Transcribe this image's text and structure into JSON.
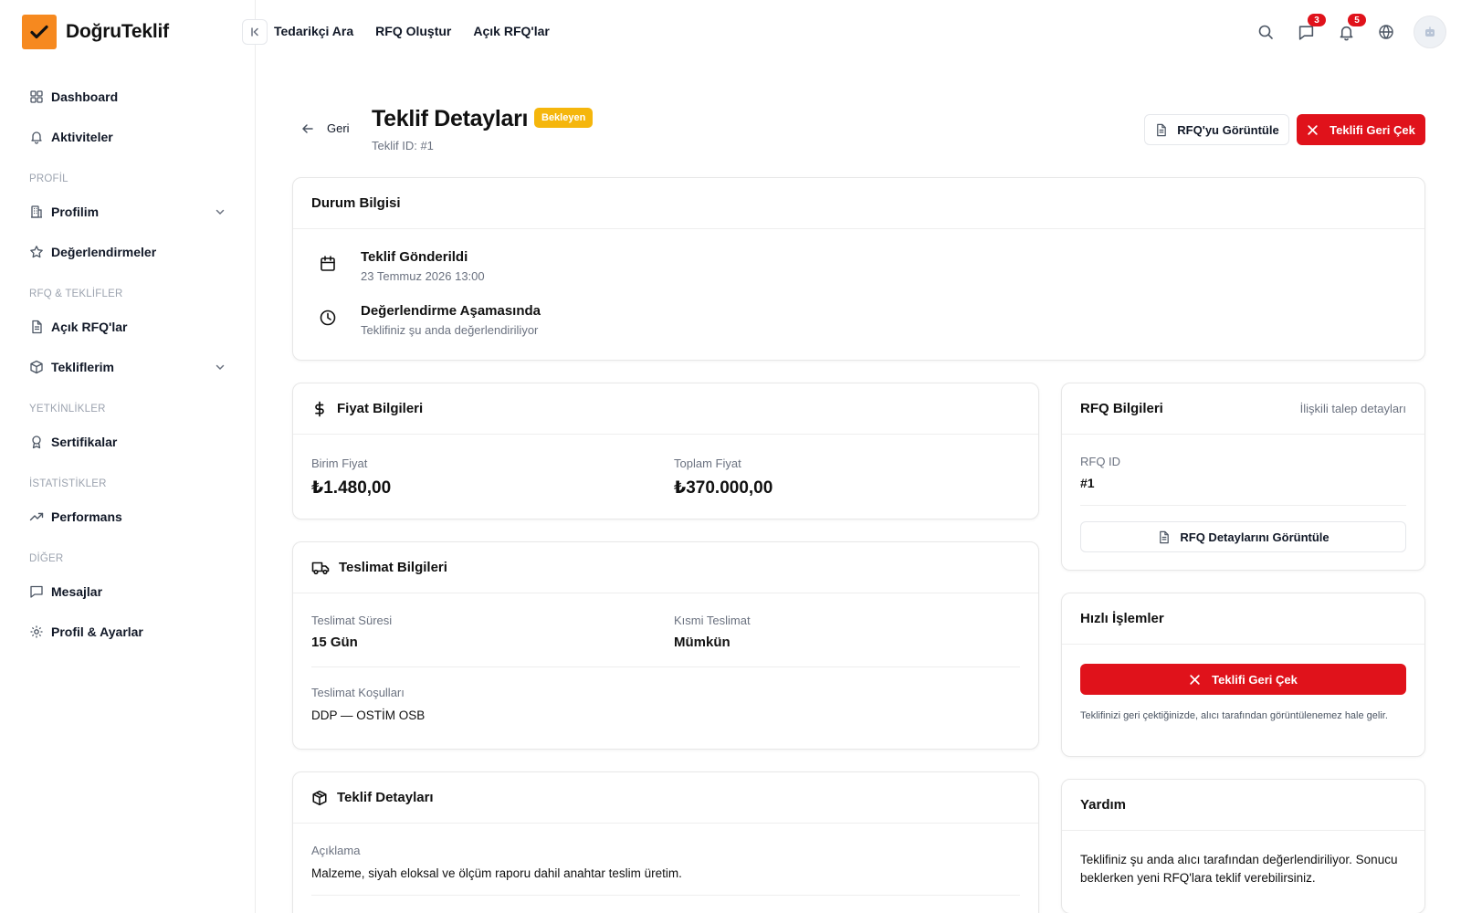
{
  "brand": {
    "name": "DoğruTeklif",
    "accent": "#f6891f"
  },
  "sidebar": {
    "items": [
      {
        "label": "Dashboard"
      },
      {
        "label": "Aktiviteler"
      },
      {
        "section": "PROFİL"
      },
      {
        "label": "Profilim"
      },
      {
        "label": "Değerlendirmeler"
      },
      {
        "section": "RFQ & TEKLİFLER"
      },
      {
        "label": "Açık RFQ'lar"
      },
      {
        "label": "Tekliflerim"
      },
      {
        "section": "YETKİNLİKLER"
      },
      {
        "label": "Sertifikalar"
      },
      {
        "section": "İSTATİSTİKLER"
      },
      {
        "label": "Performans"
      },
      {
        "section": "DİĞER"
      },
      {
        "label": "Mesajlar"
      },
      {
        "label": "Profil & Ayarlar"
      }
    ]
  },
  "topnav": {
    "items": [
      "Tedarikçi Ara",
      "RFQ Oluştur",
      "Açık RFQ'lar"
    ]
  },
  "topbar": {
    "messages_count": "3",
    "notifications_count": "5"
  },
  "header": {
    "back_label": "Geri",
    "title": "Teklif Detayları",
    "status": "Bekleyen",
    "subtitle": "Teklif ID: #1",
    "view_rfq_button": "RFQ'yu Görüntüle",
    "withdraw_button": "Teklifi Geri Çek"
  },
  "status_card": {
    "title": "Durum Bilgisi",
    "events": [
      {
        "title": "Teklif Gönderildi",
        "subtitle": "23 Temmuz 2026 13:00"
      },
      {
        "title": "Değerlendirme Aşamasında",
        "subtitle": "Teklifiniz şu anda değerlendiriliyor"
      }
    ]
  },
  "price_card": {
    "title": "Fiyat Bilgileri",
    "unit_price_label": "Birim Fiyat",
    "unit_price": "₺1.480,00",
    "total_price_label": "Toplam Fiyat",
    "total_price": "₺370.000,00"
  },
  "delivery_card": {
    "title": "Teslimat Bilgileri",
    "duration_label": "Teslimat Süresi",
    "duration": "15 Gün",
    "partial_label": "Kısmi Teslimat",
    "partial": "Mümkün",
    "terms_label": "Teslimat Koşulları",
    "terms": "DDP — OSTİM OSB"
  },
  "offer_card": {
    "title": "Teklif Detayları",
    "description_label": "Açıklama",
    "description": "Malzeme, siyah eloksal ve ölçüm raporu dahil anahtar teslim üretim."
  },
  "rfq_card": {
    "title": "RFQ Bilgileri",
    "aside": "İlişkili talep detayları",
    "id_label": "RFQ ID",
    "id": "#1",
    "details_button": "RFQ Detaylarını Görüntüle"
  },
  "quick_card": {
    "title": "Hızlı İşlemler",
    "button": "Teklifi Geri Çek",
    "note": "Teklifinizi geri çektiğinizde, alıcı tarafından görüntülenemez hale gelir."
  },
  "help_card": {
    "title": "Yardım",
    "text": "Teklifiniz şu anda alıcı tarafından değerlendiriliyor. Sonucu beklerken yeni RFQ'lara teklif verebilirsiniz."
  },
  "colors": {
    "danger": "#e0121b",
    "warning": "#f5b60c"
  }
}
